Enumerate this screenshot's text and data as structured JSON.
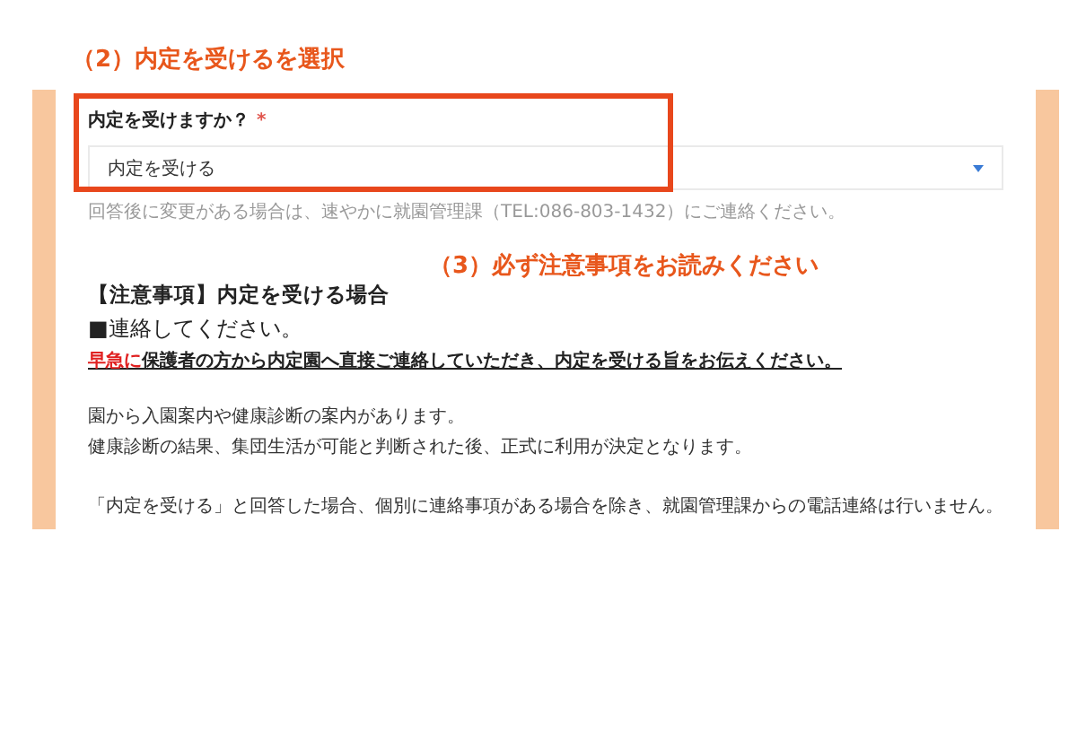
{
  "annotations": [
    {
      "text": "（2）内定を受けるを選択"
    },
    {
      "text": "（3）必ず注意事項をお読みください"
    }
  ],
  "question": {
    "label": "内定を受けますか？",
    "required_mark": "*",
    "value": "内定を受ける",
    "hint": "回答後に変更がある場合は、速やかに就園管理課（TEL:086-803-1432）にご連絡ください。"
  },
  "notice": {
    "heading": "【注意事項】内定を受ける場合",
    "subheading": "■連絡してください。",
    "emphasis": "早急に",
    "emphasis_rest": "保護者の方から内定園へ直接ご連絡していただき、内定を受ける旨をお伝えください。",
    "paragraphs": [
      [
        "園から入園案内や健康診断の案内があります。",
        "健康診断の結果、集団生活が可能と判断された後、正式に利用が決定となります。"
      ],
      [
        "「内定を受ける」と回答した場合、個別に連絡事項がある場合を除き、就園管理課からの電話連絡は行いません。"
      ]
    ]
  }
}
